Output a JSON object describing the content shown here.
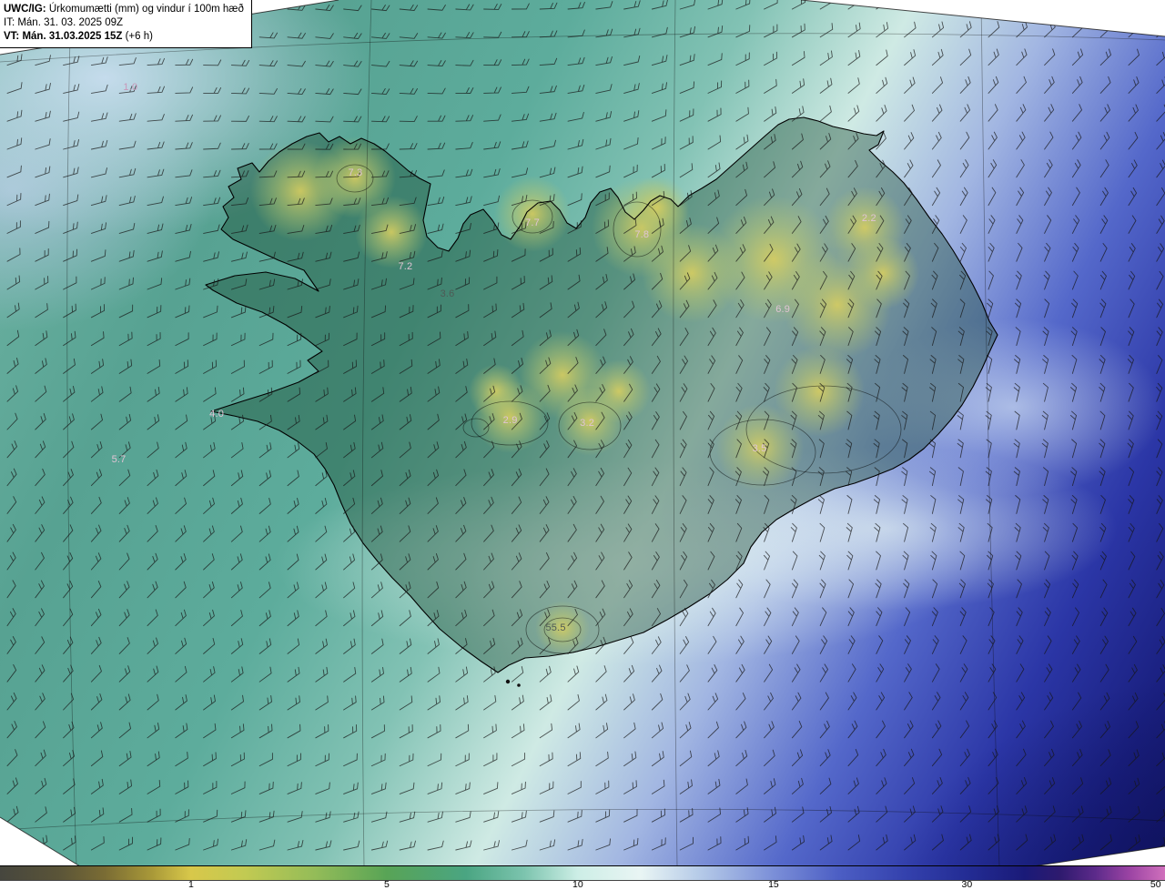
{
  "title_box": {
    "line1_bold": "UWC/IG:",
    "line1_rest": " Úrkomumætti (mm) og vindur í 100m hæð",
    "line2": "IT: Mán. 31. 03. 2025 09Z",
    "line3_bold": "VT: Mán. 31.03.2025 15Z",
    "line3_rest": " (+6 h)"
  },
  "map": {
    "precip_max_labels": [
      {
        "value": "1.0",
        "x_pct": 11.2,
        "y_pct": 10.1,
        "tone": "magenta"
      },
      {
        "value": "7.3",
        "x_pct": 30.5,
        "y_pct": 20.0,
        "tone": "pink"
      },
      {
        "value": "7.7",
        "x_pct": 45.7,
        "y_pct": 25.7,
        "tone": "pink"
      },
      {
        "value": "7.8",
        "x_pct": 55.1,
        "y_pct": 27.1,
        "tone": "pink"
      },
      {
        "value": "2.2",
        "x_pct": 74.6,
        "y_pct": 25.2,
        "tone": "pink"
      },
      {
        "value": "7.2",
        "x_pct": 34.8,
        "y_pct": 30.8,
        "tone": "pink"
      },
      {
        "value": "3.6",
        "x_pct": 38.4,
        "y_pct": 33.9,
        "tone": "gray"
      },
      {
        "value": "6.9",
        "x_pct": 67.2,
        "y_pct": 35.7,
        "tone": "pink"
      },
      {
        "value": "4.0",
        "x_pct": 18.6,
        "y_pct": 47.8,
        "tone": "pink"
      },
      {
        "value": "2.9",
        "x_pct": 43.8,
        "y_pct": 48.5,
        "tone": "pink"
      },
      {
        "value": "3.2",
        "x_pct": 50.4,
        "y_pct": 48.8,
        "tone": "pink"
      },
      {
        "value": "3.5",
        "x_pct": 65.2,
        "y_pct": 51.8,
        "tone": "pink"
      },
      {
        "value": "5.7",
        "x_pct": 10.2,
        "y_pct": 53.0,
        "tone": "pink"
      },
      {
        "value": "55.5",
        "x_pct": 47.7,
        "y_pct": 72.5,
        "tone": "gray"
      }
    ]
  },
  "colorbar": {
    "unit": "mm",
    "ticks": [
      {
        "label": "1",
        "x_pct": 16.4
      },
      {
        "label": "5",
        "x_pct": 33.2
      },
      {
        "label": "10",
        "x_pct": 49.6
      },
      {
        "label": "15",
        "x_pct": 66.4
      },
      {
        "label": "30",
        "x_pct": 83.0
      },
      {
        "label": "50",
        "x_pct": 99.2
      }
    ],
    "gradient_stops": [
      {
        "pos": 0,
        "color": "#46463e"
      },
      {
        "pos": 5,
        "color": "#5a5438"
      },
      {
        "pos": 9,
        "color": "#7a6c34"
      },
      {
        "pos": 13,
        "color": "#a89838"
      },
      {
        "pos": 16.4,
        "color": "#d8c84a"
      },
      {
        "pos": 21,
        "color": "#c2ca52"
      },
      {
        "pos": 27,
        "color": "#94bc58"
      },
      {
        "pos": 33.2,
        "color": "#58a456"
      },
      {
        "pos": 40,
        "color": "#4aa582"
      },
      {
        "pos": 45,
        "color": "#7cc4ae"
      },
      {
        "pos": 49.6,
        "color": "#cdeee6"
      },
      {
        "pos": 55,
        "color": "#e9f5f4"
      },
      {
        "pos": 60,
        "color": "#b6cbe8"
      },
      {
        "pos": 66.4,
        "color": "#7b8fd8"
      },
      {
        "pos": 72,
        "color": "#4c5ec4"
      },
      {
        "pos": 78,
        "color": "#3340ac"
      },
      {
        "pos": 83,
        "color": "#232c94"
      },
      {
        "pos": 88,
        "color": "#1a1a78"
      },
      {
        "pos": 91,
        "color": "#2e1a6e"
      },
      {
        "pos": 94,
        "color": "#5c2a8a"
      },
      {
        "pos": 97,
        "color": "#9c44a4"
      },
      {
        "pos": 100,
        "color": "#d070bc"
      }
    ]
  }
}
